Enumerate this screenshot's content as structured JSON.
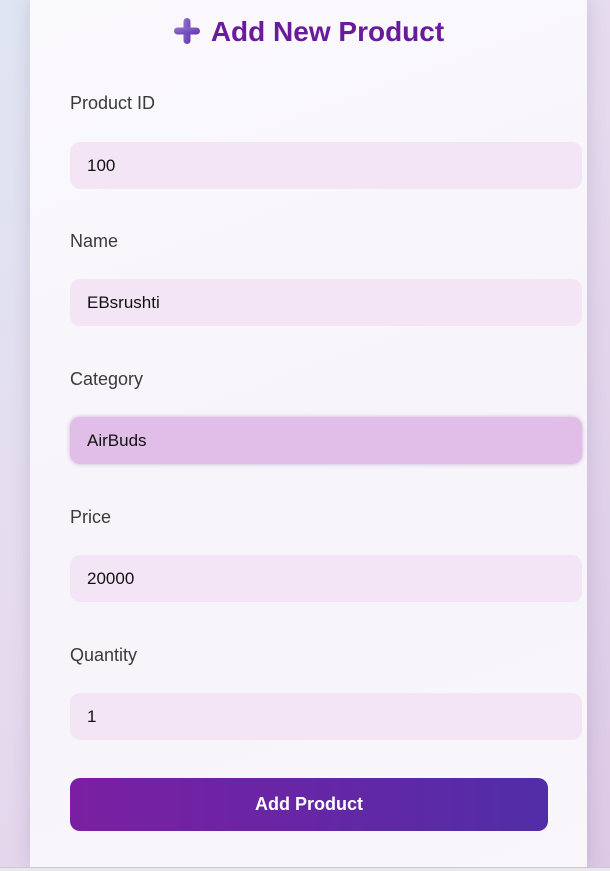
{
  "form": {
    "title": "Add New Product",
    "title_color": "#6a1b9a",
    "icon": "plus-icon",
    "fields": [
      {
        "label": "Product ID",
        "value": "100"
      },
      {
        "label": "Name",
        "value": "EBsrushti"
      },
      {
        "label": "Category",
        "value": "AirBuds"
      },
      {
        "label": "Price",
        "value": "20000"
      },
      {
        "label": "Quantity",
        "value": "1"
      }
    ],
    "input_bg": "#f3e5f5",
    "focused_input_bg": "#e1bee7",
    "submit_label": "Add Product",
    "submit_gradient": [
      "#7b1fa2",
      "#512da8"
    ]
  }
}
